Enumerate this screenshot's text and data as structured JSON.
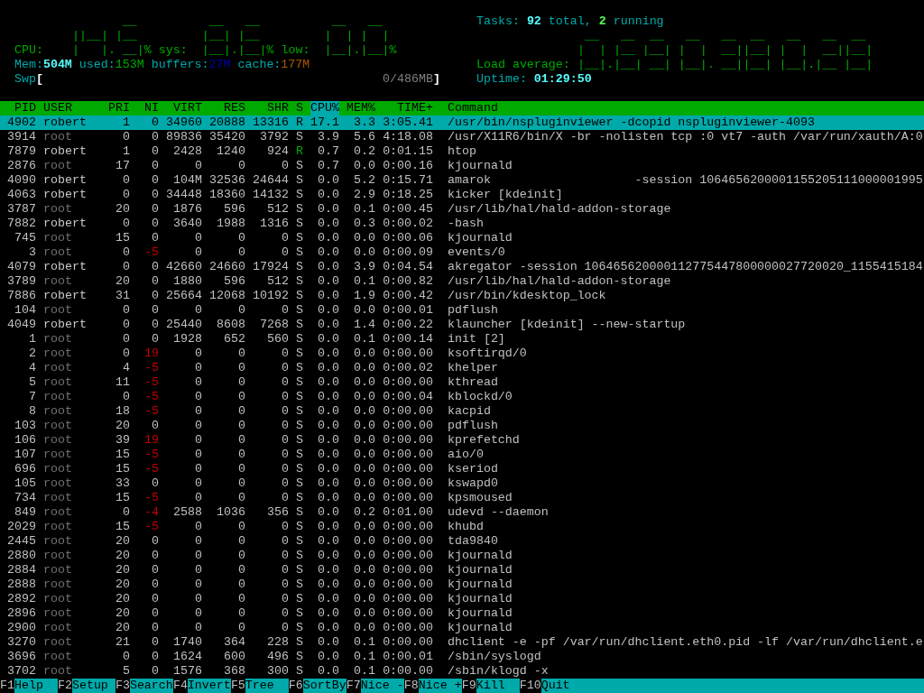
{
  "cpu_meter": [
    {
      "label": "CPU:",
      "led_top": "       __",
      "led_middle": "||__| |__",
      "led_bottom": "|   |. __|%"
    },
    {
      "label": "sys:",
      "led_top": " __   __",
      "led_middle": "|__| |__",
      "led_bottom": "|__|.|__|%"
    },
    {
      "label": "low:",
      "led_top": " __   __",
      "led_middle": "|  | |  |",
      "led_bottom": "|__|.|__|%"
    }
  ],
  "memory": {
    "label": "Mem:",
    "total": "504M",
    "parts": [
      {
        "label": "used:",
        "value": "153M",
        "color": "#00aa00"
      },
      {
        "label": "buffers:",
        "value": "27M",
        "color": "#0000aa"
      },
      {
        "label": "cache:",
        "value": "177M",
        "color": "#aa5500"
      }
    ]
  },
  "swap": {
    "label": "Swp",
    "open": "[",
    "reading": "0/486MB",
    "close": "]"
  },
  "tasks": {
    "label": "Tasks:",
    "total": "92",
    "total_label": "total,",
    "running": "2",
    "running_label": "running"
  },
  "load_average": {
    "label": "Load average:",
    "led_top": " __   __  __   __   __  __   __   __  __",
    "led_middle": "|  | |__ |__| |  |  __||__| |  |  __||__|",
    "led_bottom": "|__|.|__| __| |__|. __||__| |__|.|__ |__|"
  },
  "uptime": {
    "label": "Uptime:",
    "value": "01:29:50"
  },
  "table": {
    "columns": [
      {
        "label": "PID",
        "sorted": false
      },
      {
        "label": "USER",
        "sorted": false
      },
      {
        "label": "PRI",
        "sorted": false
      },
      {
        "label": "NI",
        "sorted": false
      },
      {
        "label": "VIRT",
        "sorted": false
      },
      {
        "label": "RES",
        "sorted": false
      },
      {
        "label": "SHR",
        "sorted": false
      },
      {
        "label": "S",
        "sorted": false
      },
      {
        "label": "CPU%",
        "sorted": true
      },
      {
        "label": "MEM%",
        "sorted": false
      },
      {
        "label": "TIME+",
        "sorted": false
      },
      {
        "label": "Command",
        "sorted": false
      }
    ],
    "rows": [
      {
        "pid": "4902",
        "user": "robert",
        "pri": "1",
        "ni": "0",
        "virt": "34960",
        "res": "20888",
        "shr": "13316",
        "s": "R",
        "cpu": "17.1",
        "mem": "3.3",
        "time": "3:05.41",
        "command": "/usr/bin/nspluginviewer -dcopid nspluginviewer-4093",
        "selected": true,
        "system_user": false,
        "nice_highlighted": false,
        "running": true
      },
      {
        "pid": "3914",
        "user": "root",
        "pri": "0",
        "ni": "0",
        "virt": "89836",
        "res": "35420",
        "shr": "3792",
        "s": "S",
        "cpu": "3.9",
        "mem": "5.6",
        "time": "4:18.08",
        "command": "/usr/X11R6/bin/X -br -nolisten tcp :0 vt7 -auth /var/run/xauth/A:0",
        "selected": false,
        "system_user": true,
        "nice_highlighted": false,
        "running": false
      },
      {
        "pid": "7879",
        "user": "robert",
        "pri": "1",
        "ni": "0",
        "virt": "2428",
        "res": "1240",
        "shr": "924",
        "s": "R",
        "cpu": "0.7",
        "mem": "0.2",
        "time": "0:01.15",
        "command": "htop",
        "selected": false,
        "system_user": false,
        "nice_highlighted": false,
        "running": true
      },
      {
        "pid": "2876",
        "user": "root",
        "pri": "17",
        "ni": "0",
        "virt": "0",
        "res": "0",
        "shr": "0",
        "s": "S",
        "cpu": "0.7",
        "mem": "0.0",
        "time": "0:00.16",
        "command": "kjournald",
        "selected": false,
        "system_user": true,
        "nice_highlighted": false,
        "running": false
      },
      {
        "pid": "4090",
        "user": "robert",
        "pri": "0",
        "ni": "0",
        "virt": "104M",
        "res": "32536",
        "shr": "24644",
        "s": "S",
        "cpu": "0.0",
        "mem": "5.2",
        "time": "0:15.71",
        "command": "amarok                    -session 1064656200001155205111000001995",
        "selected": false,
        "system_user": false,
        "nice_highlighted": false,
        "running": false
      },
      {
        "pid": "4063",
        "user": "robert",
        "pri": "0",
        "ni": "0",
        "virt": "34448",
        "res": "18360",
        "shr": "14132",
        "s": "S",
        "cpu": "0.0",
        "mem": "2.9",
        "time": "0:18.25",
        "command": "kicker [kdeinit]",
        "selected": false,
        "system_user": false,
        "nice_highlighted": false,
        "running": false
      },
      {
        "pid": "3787",
        "user": "root",
        "pri": "20",
        "ni": "0",
        "virt": "1876",
        "res": "596",
        "shr": "512",
        "s": "S",
        "cpu": "0.0",
        "mem": "0.1",
        "time": "0:00.45",
        "command": "/usr/lib/hal/hald-addon-storage",
        "selected": false,
        "system_user": true,
        "nice_highlighted": false,
        "running": false
      },
      {
        "pid": "7882",
        "user": "robert",
        "pri": "0",
        "ni": "0",
        "virt": "3640",
        "res": "1988",
        "shr": "1316",
        "s": "S",
        "cpu": "0.0",
        "mem": "0.3",
        "time": "0:00.02",
        "command": "-bash",
        "selected": false,
        "system_user": false,
        "nice_highlighted": false,
        "running": false
      },
      {
        "pid": "745",
        "user": "root",
        "pri": "15",
        "ni": "0",
        "virt": "0",
        "res": "0",
        "shr": "0",
        "s": "S",
        "cpu": "0.0",
        "mem": "0.0",
        "time": "0:00.06",
        "command": "kjournald",
        "selected": false,
        "system_user": true,
        "nice_highlighted": false,
        "running": false
      },
      {
        "pid": "3",
        "user": "root",
        "pri": "0",
        "ni": "-5",
        "virt": "0",
        "res": "0",
        "shr": "0",
        "s": "S",
        "cpu": "0.0",
        "mem": "0.0",
        "time": "0:00.09",
        "command": "events/0",
        "selected": false,
        "system_user": true,
        "nice_highlighted": true,
        "running": false
      },
      {
        "pid": "4079",
        "user": "robert",
        "pri": "0",
        "ni": "0",
        "virt": "42660",
        "res": "24660",
        "shr": "17924",
        "s": "S",
        "cpu": "0.0",
        "mem": "3.9",
        "time": "0:04.54",
        "command": "akregator -session 106465620000112775447800000027720020_1155415184",
        "selected": false,
        "system_user": false,
        "nice_highlighted": false,
        "running": false
      },
      {
        "pid": "3789",
        "user": "root",
        "pri": "20",
        "ni": "0",
        "virt": "1880",
        "res": "596",
        "shr": "512",
        "s": "S",
        "cpu": "0.0",
        "mem": "0.1",
        "time": "0:00.82",
        "command": "/usr/lib/hal/hald-addon-storage",
        "selected": false,
        "system_user": true,
        "nice_highlighted": false,
        "running": false
      },
      {
        "pid": "7886",
        "user": "robert",
        "pri": "31",
        "ni": "0",
        "virt": "25664",
        "res": "12068",
        "shr": "10192",
        "s": "S",
        "cpu": "0.0",
        "mem": "1.9",
        "time": "0:00.42",
        "command": "/usr/bin/kdesktop_lock",
        "selected": false,
        "system_user": false,
        "nice_highlighted": false,
        "running": false
      },
      {
        "pid": "104",
        "user": "root",
        "pri": "0",
        "ni": "0",
        "virt": "0",
        "res": "0",
        "shr": "0",
        "s": "S",
        "cpu": "0.0",
        "mem": "0.0",
        "time": "0:00.01",
        "command": "pdflush",
        "selected": false,
        "system_user": true,
        "nice_highlighted": false,
        "running": false
      },
      {
        "pid": "4049",
        "user": "robert",
        "pri": "0",
        "ni": "0",
        "virt": "25440",
        "res": "8608",
        "shr": "7268",
        "s": "S",
        "cpu": "0.0",
        "mem": "1.4",
        "time": "0:00.22",
        "command": "klauncher [kdeinit] --new-startup",
        "selected": false,
        "system_user": false,
        "nice_highlighted": false,
        "running": false
      },
      {
        "pid": "1",
        "user": "root",
        "pri": "0",
        "ni": "0",
        "virt": "1928",
        "res": "652",
        "shr": "560",
        "s": "S",
        "cpu": "0.0",
        "mem": "0.1",
        "time": "0:00.14",
        "command": "init [2]",
        "selected": false,
        "system_user": true,
        "nice_highlighted": false,
        "running": false
      },
      {
        "pid": "2",
        "user": "root",
        "pri": "0",
        "ni": "19",
        "virt": "0",
        "res": "0",
        "shr": "0",
        "s": "S",
        "cpu": "0.0",
        "mem": "0.0",
        "time": "0:00.00",
        "command": "ksoftirqd/0",
        "selected": false,
        "system_user": true,
        "nice_highlighted": true,
        "running": false
      },
      {
        "pid": "4",
        "user": "root",
        "pri": "4",
        "ni": "-5",
        "virt": "0",
        "res": "0",
        "shr": "0",
        "s": "S",
        "cpu": "0.0",
        "mem": "0.0",
        "time": "0:00.02",
        "command": "khelper",
        "selected": false,
        "system_user": true,
        "nice_highlighted": true,
        "running": false
      },
      {
        "pid": "5",
        "user": "root",
        "pri": "11",
        "ni": "-5",
        "virt": "0",
        "res": "0",
        "shr": "0",
        "s": "S",
        "cpu": "0.0",
        "mem": "0.0",
        "time": "0:00.00",
        "command": "kthread",
        "selected": false,
        "system_user": true,
        "nice_highlighted": true,
        "running": false
      },
      {
        "pid": "7",
        "user": "root",
        "pri": "0",
        "ni": "-5",
        "virt": "0",
        "res": "0",
        "shr": "0",
        "s": "S",
        "cpu": "0.0",
        "mem": "0.0",
        "time": "0:00.04",
        "command": "kblockd/0",
        "selected": false,
        "system_user": true,
        "nice_highlighted": true,
        "running": false
      },
      {
        "pid": "8",
        "user": "root",
        "pri": "18",
        "ni": "-5",
        "virt": "0",
        "res": "0",
        "shr": "0",
        "s": "S",
        "cpu": "0.0",
        "mem": "0.0",
        "time": "0:00.00",
        "command": "kacpid",
        "selected": false,
        "system_user": true,
        "nice_highlighted": true,
        "running": false
      },
      {
        "pid": "103",
        "user": "root",
        "pri": "20",
        "ni": "0",
        "virt": "0",
        "res": "0",
        "shr": "0",
        "s": "S",
        "cpu": "0.0",
        "mem": "0.0",
        "time": "0:00.00",
        "command": "pdflush",
        "selected": false,
        "system_user": true,
        "nice_highlighted": false,
        "running": false
      },
      {
        "pid": "106",
        "user": "root",
        "pri": "39",
        "ni": "19",
        "virt": "0",
        "res": "0",
        "shr": "0",
        "s": "S",
        "cpu": "0.0",
        "mem": "0.0",
        "time": "0:00.00",
        "command": "kprefetchd",
        "selected": false,
        "system_user": true,
        "nice_highlighted": true,
        "running": false
      },
      {
        "pid": "107",
        "user": "root",
        "pri": "15",
        "ni": "-5",
        "virt": "0",
        "res": "0",
        "shr": "0",
        "s": "S",
        "cpu": "0.0",
        "mem": "0.0",
        "time": "0:00.00",
        "command": "aio/0",
        "selected": false,
        "system_user": true,
        "nice_highlighted": true,
        "running": false
      },
      {
        "pid": "696",
        "user": "root",
        "pri": "15",
        "ni": "-5",
        "virt": "0",
        "res": "0",
        "shr": "0",
        "s": "S",
        "cpu": "0.0",
        "mem": "0.0",
        "time": "0:00.00",
        "command": "kseriod",
        "selected": false,
        "system_user": true,
        "nice_highlighted": true,
        "running": false
      },
      {
        "pid": "105",
        "user": "root",
        "pri": "33",
        "ni": "0",
        "virt": "0",
        "res": "0",
        "shr": "0",
        "s": "S",
        "cpu": "0.0",
        "mem": "0.0",
        "time": "0:00.00",
        "command": "kswapd0",
        "selected": false,
        "system_user": true,
        "nice_highlighted": false,
        "running": false
      },
      {
        "pid": "734",
        "user": "root",
        "pri": "15",
        "ni": "-5",
        "virt": "0",
        "res": "0",
        "shr": "0",
        "s": "S",
        "cpu": "0.0",
        "mem": "0.0",
        "time": "0:00.00",
        "command": "kpsmoused",
        "selected": false,
        "system_user": true,
        "nice_highlighted": true,
        "running": false
      },
      {
        "pid": "849",
        "user": "root",
        "pri": "0",
        "ni": "-4",
        "virt": "2588",
        "res": "1036",
        "shr": "356",
        "s": "S",
        "cpu": "0.0",
        "mem": "0.2",
        "time": "0:01.00",
        "command": "udevd --daemon",
        "selected": false,
        "system_user": true,
        "nice_highlighted": true,
        "running": false
      },
      {
        "pid": "2029",
        "user": "root",
        "pri": "15",
        "ni": "-5",
        "virt": "0",
        "res": "0",
        "shr": "0",
        "s": "S",
        "cpu": "0.0",
        "mem": "0.0",
        "time": "0:00.00",
        "command": "khubd",
        "selected": false,
        "system_user": true,
        "nice_highlighted": true,
        "running": false
      },
      {
        "pid": "2445",
        "user": "root",
        "pri": "20",
        "ni": "0",
        "virt": "0",
        "res": "0",
        "shr": "0",
        "s": "S",
        "cpu": "0.0",
        "mem": "0.0",
        "time": "0:00.00",
        "command": "tda9840",
        "selected": false,
        "system_user": true,
        "nice_highlighted": false,
        "running": false
      },
      {
        "pid": "2880",
        "user": "root",
        "pri": "20",
        "ni": "0",
        "virt": "0",
        "res": "0",
        "shr": "0",
        "s": "S",
        "cpu": "0.0",
        "mem": "0.0",
        "time": "0:00.00",
        "command": "kjournald",
        "selected": false,
        "system_user": true,
        "nice_highlighted": false,
        "running": false
      },
      {
        "pid": "2884",
        "user": "root",
        "pri": "20",
        "ni": "0",
        "virt": "0",
        "res": "0",
        "shr": "0",
        "s": "S",
        "cpu": "0.0",
        "mem": "0.0",
        "time": "0:00.00",
        "command": "kjournald",
        "selected": false,
        "system_user": true,
        "nice_highlighted": false,
        "running": false
      },
      {
        "pid": "2888",
        "user": "root",
        "pri": "20",
        "ni": "0",
        "virt": "0",
        "res": "0",
        "shr": "0",
        "s": "S",
        "cpu": "0.0",
        "mem": "0.0",
        "time": "0:00.00",
        "command": "kjournald",
        "selected": false,
        "system_user": true,
        "nice_highlighted": false,
        "running": false
      },
      {
        "pid": "2892",
        "user": "root",
        "pri": "20",
        "ni": "0",
        "virt": "0",
        "res": "0",
        "shr": "0",
        "s": "S",
        "cpu": "0.0",
        "mem": "0.0",
        "time": "0:00.00",
        "command": "kjournald",
        "selected": false,
        "system_user": true,
        "nice_highlighted": false,
        "running": false
      },
      {
        "pid": "2896",
        "user": "root",
        "pri": "20",
        "ni": "0",
        "virt": "0",
        "res": "0",
        "shr": "0",
        "s": "S",
        "cpu": "0.0",
        "mem": "0.0",
        "time": "0:00.00",
        "command": "kjournald",
        "selected": false,
        "system_user": true,
        "nice_highlighted": false,
        "running": false
      },
      {
        "pid": "2900",
        "user": "root",
        "pri": "20",
        "ni": "0",
        "virt": "0",
        "res": "0",
        "shr": "0",
        "s": "S",
        "cpu": "0.0",
        "mem": "0.0",
        "time": "0:00.00",
        "command": "kjournald",
        "selected": false,
        "system_user": true,
        "nice_highlighted": false,
        "running": false
      },
      {
        "pid": "3270",
        "user": "root",
        "pri": "21",
        "ni": "0",
        "virt": "1740",
        "res": "364",
        "shr": "228",
        "s": "S",
        "cpu": "0.0",
        "mem": "0.1",
        "time": "0:00.00",
        "command": "dhclient -e -pf /var/run/dhclient.eth0.pid -lf /var/run/dhclient.e",
        "selected": false,
        "system_user": true,
        "nice_highlighted": false,
        "running": false
      },
      {
        "pid": "3696",
        "user": "root",
        "pri": "0",
        "ni": "0",
        "virt": "1624",
        "res": "600",
        "shr": "496",
        "s": "S",
        "cpu": "0.0",
        "mem": "0.1",
        "time": "0:00.01",
        "command": "/sbin/syslogd",
        "selected": false,
        "system_user": true,
        "nice_highlighted": false,
        "running": false
      },
      {
        "pid": "3702",
        "user": "root",
        "pri": "5",
        "ni": "0",
        "virt": "1576",
        "res": "368",
        "shr": "300",
        "s": "S",
        "cpu": "0.0",
        "mem": "0.1",
        "time": "0:00.00",
        "command": "/sbin/klogd -x",
        "selected": false,
        "system_user": true,
        "nice_highlighted": false,
        "running": false
      }
    ]
  },
  "function_keys": [
    {
      "key": "F1",
      "label": "Help"
    },
    {
      "key": "F2",
      "label": "Setup"
    },
    {
      "key": "F3",
      "label": "Search"
    },
    {
      "key": "F4",
      "label": "Invert"
    },
    {
      "key": "F5",
      "label": "Tree"
    },
    {
      "key": "F6",
      "label": "SortBy"
    },
    {
      "key": "F7",
      "label": "Nice -"
    },
    {
      "key": "F8",
      "label": "Nice +"
    },
    {
      "key": "F9",
      "label": "Kill"
    },
    {
      "key": "F10",
      "label": "Quit"
    }
  ]
}
